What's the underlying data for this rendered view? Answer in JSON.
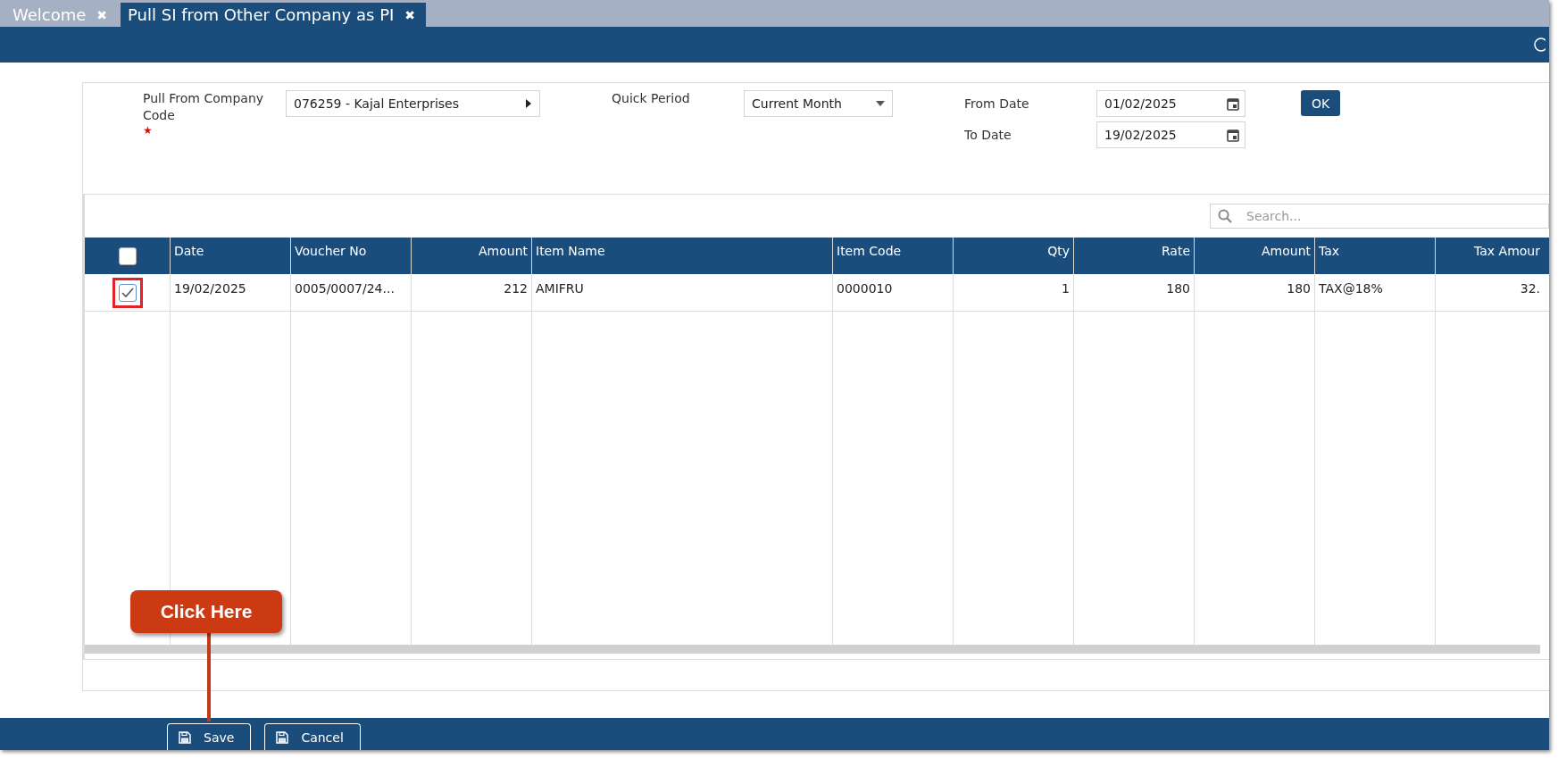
{
  "tabs": [
    {
      "label": "Welcome",
      "selected": false,
      "close": "✖"
    },
    {
      "label": "Pull SI from Other Company as PI",
      "selected": true,
      "close": "✖"
    }
  ],
  "form": {
    "company_label": "Pull From Company Code",
    "required_mark": "★",
    "company_value": "076259 - Kajal Enterprises",
    "quick_period_label": "Quick Period",
    "quick_period_value": "Current Month",
    "from_date_label": "From Date",
    "from_date": "01/02/2025",
    "to_date_label": "To Date",
    "to_date": "19/02/2025",
    "ok_button": "OK"
  },
  "search": {
    "placeholder": "Search..."
  },
  "table": {
    "select_all": {
      "checked": false
    },
    "columns": [
      {
        "label": "Date"
      },
      {
        "label": "Voucher No"
      },
      {
        "label": "Amount"
      },
      {
        "label": "Item Name"
      },
      {
        "label": "Item Code"
      },
      {
        "label": "Qty"
      },
      {
        "label": "Rate"
      },
      {
        "label": "Amount"
      },
      {
        "label": "Tax"
      },
      {
        "label": "Tax Amour"
      }
    ],
    "rows": [
      {
        "checked": true,
        "highlighted": true,
        "cells": [
          "19/02/2025",
          "0005/0007/24...",
          "212",
          "AMIFRU",
          "0000010",
          "1",
          "180",
          "180",
          "TAX@18%",
          "32."
        ]
      }
    ]
  },
  "callout": {
    "text": "Click Here"
  },
  "footer_buttons": [
    {
      "label": "Save"
    },
    {
      "label": "Cancel"
    }
  ]
}
